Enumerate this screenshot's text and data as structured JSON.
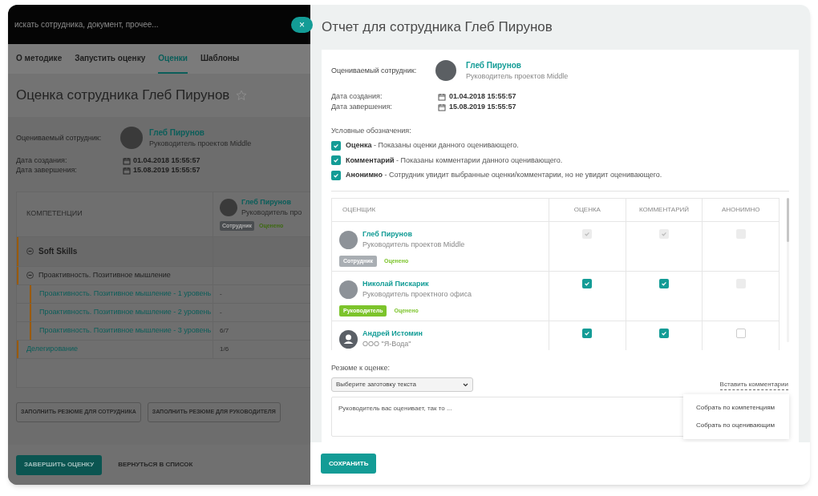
{
  "background_page": {
    "search": {
      "placeholder": "искать сотрудника, документ, прочее..."
    },
    "nav_tabs": [
      {
        "label": "О методике",
        "selected": false
      },
      {
        "label": "Запустить оценку",
        "selected": false
      },
      {
        "label": "Оценки",
        "selected": true
      },
      {
        "label": "Шаблоны",
        "selected": false
      }
    ],
    "title": "Оценка сотрудника Глеб Пирунов",
    "evaluated_label": "Оцениваемый сотрудник:",
    "employee": {
      "name": "Глеб Пирунов",
      "position": "Руководитель проектов Middle"
    },
    "dates": [
      {
        "label": "Дата создания:",
        "value": "01.04.2018 15:55:57"
      },
      {
        "label": "Дата завершения:",
        "value": "15.08.2019 15:55:57"
      }
    ],
    "competencies": {
      "header": "КОМПЕТЕНЦИИ",
      "evaluator": {
        "name": "Глеб Пирунов",
        "position": "Руководитель про",
        "role": "Сотрудник",
        "status": "Оценено"
      },
      "rows": [
        {
          "label": "Soft Skills",
          "expanded": true,
          "children": [
            {
              "label": "Проактивность. Позитивное мышление",
              "expanded": true,
              "children": [
                {
                  "label": "Проактивность. Позитивное мышление - 1 уровень",
                  "value": "-"
                },
                {
                  "label": "Проактивность. Позитивное мышление - 2 уровень",
                  "value": "-"
                },
                {
                  "label": "Проактивность. Позитивное мышление - 3 уровень",
                  "value": "6/7"
                }
              ]
            }
          ]
        },
        {
          "label": "Делегирование",
          "value": "1/6"
        }
      ]
    },
    "summary_buttons": [
      "ЗАПОЛНИТЬ РЕЗЮМЕ ДЛЯ СОТРУДНИКА",
      "ЗАПОЛНИТЬ РЕЗЮМЕ ДЛЯ РУКОВОДИТЕЛЯ"
    ],
    "footer": {
      "primary": "ЗАВЕРШИТЬ ОЦЕНКУ",
      "secondary": "ВЕРНУТЬСЯ В СПИСОК"
    }
  },
  "close_button": "×",
  "report": {
    "title": "Отчет для сотрудника Глеб Пирунов",
    "evaluated_label": "Оцениваемый сотрудник:",
    "employee": {
      "name": "Глеб Пирунов",
      "position": "Руководитель проектов Middle"
    },
    "dates": [
      {
        "label": "Дата создания:",
        "value": "01.04.2018 15:55:57"
      },
      {
        "label": "Дата завершения:",
        "value": "15.08.2019 15:55:57"
      }
    ],
    "legend_title": "Условные обозначения:",
    "legend": [
      {
        "text": "**Оценка** - Показаны оценки данного оценивающего.",
        "checked": true
      },
      {
        "text": "**Комментарий** - Показаны комментарии данного оценивающего.",
        "checked": true
      },
      {
        "text": "**Анонимно** - Сотрудник увидит выбранные оценки/комментарии, но не увидит оценивающего.",
        "checked": true
      }
    ],
    "table": {
      "columns": [
        "ОЦЕНЩИК",
        "ОЦЕНКА",
        "КОММЕНТАРИЙ",
        "АНОНИМНО"
      ],
      "rows": [
        {
          "name": "Глеб Пирунов",
          "position": "Руководитель проектов Middle",
          "kind": "photo",
          "role": {
            "label": "Сотрудник",
            "color": "#a9aeb3"
          },
          "status": "Оценено",
          "cells": [
            {
              "checked": true,
              "disabled": true
            },
            {
              "checked": true,
              "disabled": true
            },
            {
              "checked": false,
              "disabled": true
            }
          ]
        },
        {
          "name": "Николай Пискарик",
          "position": "Руководитель проектного офиса",
          "kind": "photo",
          "role": {
            "label": "Руководитель",
            "color": "#7cc42b"
          },
          "status": "Оценено",
          "cells": [
            {
              "checked": true,
              "disabled": false
            },
            {
              "checked": true,
              "disabled": false
            },
            {
              "checked": false,
              "disabled": true
            }
          ]
        },
        {
          "name": "Андрей Истомин",
          "position": "ООО \"Я-Вода\"",
          "kind": "placeholder",
          "cells": [
            {
              "checked": true,
              "disabled": false
            },
            {
              "checked": true,
              "disabled": false
            },
            {
              "checked": false,
              "disabled": false
            }
          ]
        }
      ]
    },
    "summary_label": "Резюме к оценке:",
    "template_select": {
      "placeholder": "Выберите заготовку текста"
    },
    "insert_comments": "Вставить комментарии",
    "summary_text": "Руководитель вас оценивает, так то ...",
    "insert_menu": [
      "Собрать по компетенциям",
      "Собрать по оценивающим"
    ],
    "save_button": "СОХРАНИТЬ"
  }
}
